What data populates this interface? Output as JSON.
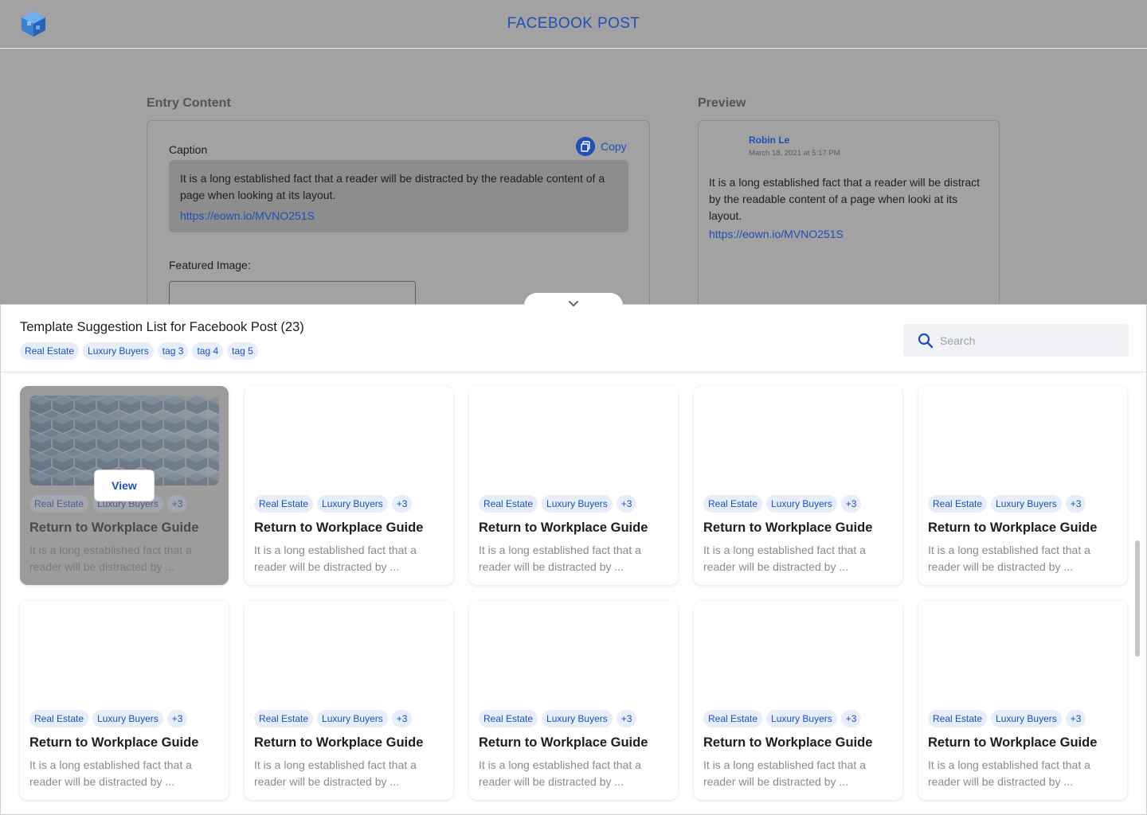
{
  "header": {
    "title": "FACEBOOK POST"
  },
  "entry": {
    "section_label": "Entry Content",
    "caption_label": "Caption",
    "copy_label": "Copy",
    "caption_text": "It is a long established fact that a reader will be distracted by the readable content of a page when looking at its layout.",
    "caption_link": "https://eown.io/MVNO251S",
    "featured_label": "Featured Image:"
  },
  "preview": {
    "section_label": "Preview",
    "author": "Robin Le",
    "date": "March 18, 2021 at 5:17 PM",
    "text": "It is a long established fact that a reader will be distract by the readable content of a page when looki at its layout.",
    "link": "https://eown.io/MVNO251S"
  },
  "panel": {
    "title": "Template Suggestion List for Facebook Post (23)",
    "tags": [
      "Real Estate",
      "Luxury Buyers",
      "tag 3",
      "tag 4",
      "tag 5"
    ],
    "search_placeholder": "Search",
    "view_label": "View"
  },
  "cards": [
    {
      "title": "Return to Workplace Guide",
      "desc": "It is a long established fact that a reader will be distracted by ...",
      "tags": [
        "Real Estate",
        "Luxury Buyers",
        "+3"
      ],
      "has_image": true,
      "active": true
    },
    {
      "title": "Return to Workplace Guide",
      "desc": "It is a long established fact that a reader will be distracted by ...",
      "tags": [
        "Real Estate",
        "Luxury Buyers",
        "+3"
      ],
      "has_image": false,
      "active": false
    },
    {
      "title": "Return to Workplace Guide",
      "desc": "It is a long established fact that a reader will be distracted by ...",
      "tags": [
        "Real Estate",
        "Luxury Buyers",
        "+3"
      ],
      "has_image": false,
      "active": false
    },
    {
      "title": "Return to Workplace Guide",
      "desc": "It is a long established fact that a reader will be distracted by ...",
      "tags": [
        "Real Estate",
        "Luxury Buyers",
        "+3"
      ],
      "has_image": false,
      "active": false
    },
    {
      "title": "Return to Workplace Guide",
      "desc": "It is a long established fact that a reader will be distracted by ...",
      "tags": [
        "Real Estate",
        "Luxury Buyers",
        "+3"
      ],
      "has_image": false,
      "active": false
    },
    {
      "title": "Return to Workplace Guide",
      "desc": "It is a long established fact that a reader will be distracted by ...",
      "tags": [
        "Real Estate",
        "Luxury Buyers",
        "+3"
      ],
      "has_image": false,
      "active": false
    },
    {
      "title": "Return to Workplace Guide",
      "desc": "It is a long established fact that a reader will be distracted by ...",
      "tags": [
        "Real Estate",
        "Luxury Buyers",
        "+3"
      ],
      "has_image": false,
      "active": false
    },
    {
      "title": "Return to Workplace Guide",
      "desc": "It is a long established fact that a reader will be distracted by ...",
      "tags": [
        "Real Estate",
        "Luxury Buyers",
        "+3"
      ],
      "has_image": false,
      "active": false
    },
    {
      "title": "Return to Workplace Guide",
      "desc": "It is a long established fact that a reader will be distracted by ...",
      "tags": [
        "Real Estate",
        "Luxury Buyers",
        "+3"
      ],
      "has_image": false,
      "active": false
    },
    {
      "title": "Return to Workplace Guide",
      "desc": "It is a long established fact that a reader will be distracted by ...",
      "tags": [
        "Real Estate",
        "Luxury Buyers",
        "+3"
      ],
      "has_image": false,
      "active": false
    }
  ],
  "colors": {
    "accent": "#1f4fb7",
    "tag_bg": "#e6eefb",
    "overlay_gray": "#a2a2a2"
  },
  "icons": {
    "logo": "cube-logo-icon",
    "copy": "copy-icon",
    "collapse": "chevron-down-icon",
    "search": "search-icon"
  }
}
